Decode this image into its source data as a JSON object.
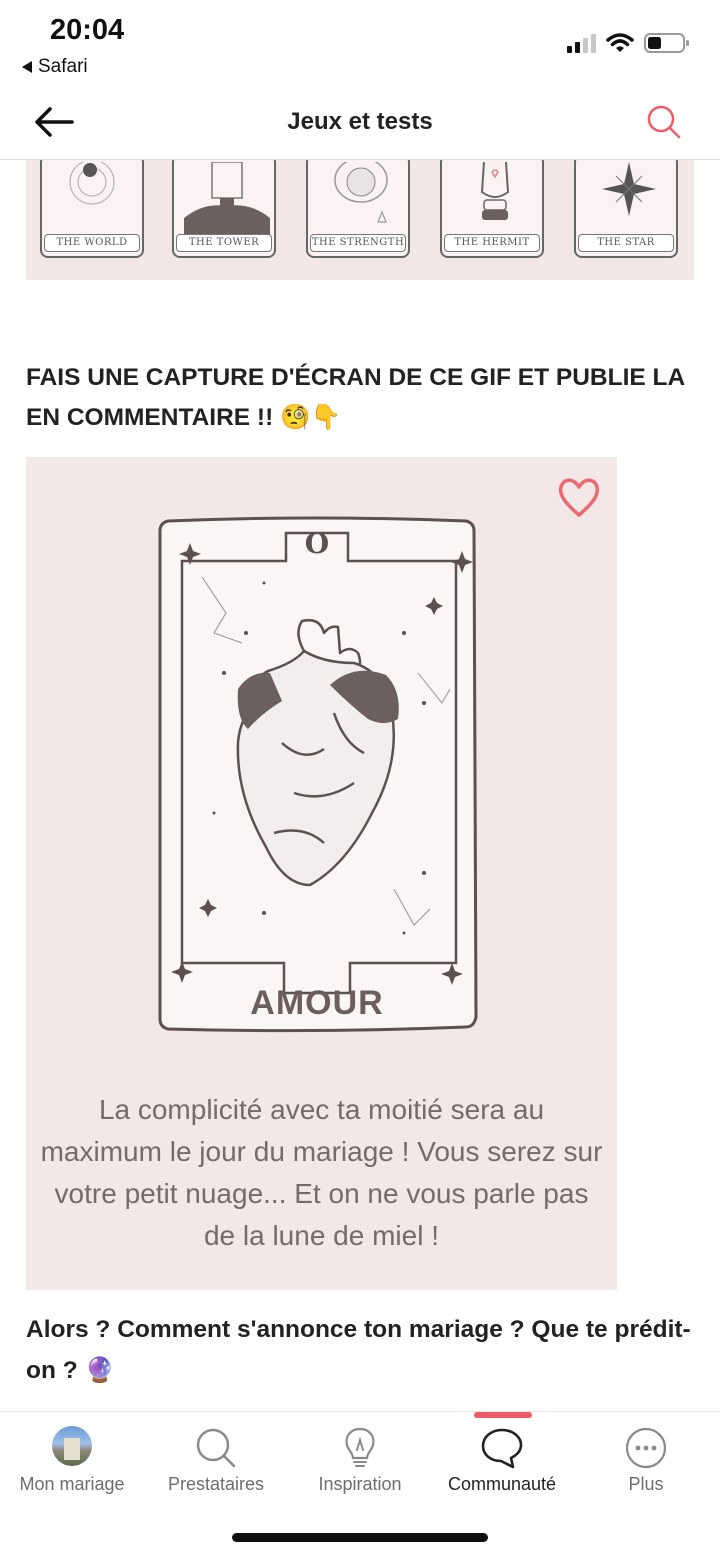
{
  "status_bar": {
    "time": "20:04",
    "back_app": "Safari"
  },
  "header": {
    "title": "Jeux et tests"
  },
  "tarot_strip": {
    "cards": [
      "THE WORLD",
      "THE TOWER",
      "THE STRENGTH",
      "THE HERMIT",
      "THE STAR"
    ]
  },
  "post": {
    "heading": "FAIS UNE CAPTURE D'ÉCRAN DE CE GIF ET PUBLIE LA EN COMMENTAIRE !! 🧐👇",
    "gif": {
      "card_number": "O",
      "card_title": "AMOUR",
      "text": "La complicité avec ta moitié sera au maximum le jour du mariage ! Vous serez sur votre petit nuage... Et on ne vous parle pas de la lune de miel !"
    },
    "question": "Alors ? Comment s'annonce ton mariage ? Que te prédit-on ? 🔮"
  },
  "tabbar": {
    "active": "Communauté",
    "accent_color": "#ef5b67",
    "items": [
      {
        "label": "Mon mariage",
        "icon": "avatar-icon"
      },
      {
        "label": "Prestataires",
        "icon": "search-icon"
      },
      {
        "label": "Inspiration",
        "icon": "lightbulb-icon"
      },
      {
        "label": "Communauté",
        "icon": "chat-bubble-icon"
      },
      {
        "label": "Plus",
        "icon": "more-icon"
      }
    ]
  }
}
